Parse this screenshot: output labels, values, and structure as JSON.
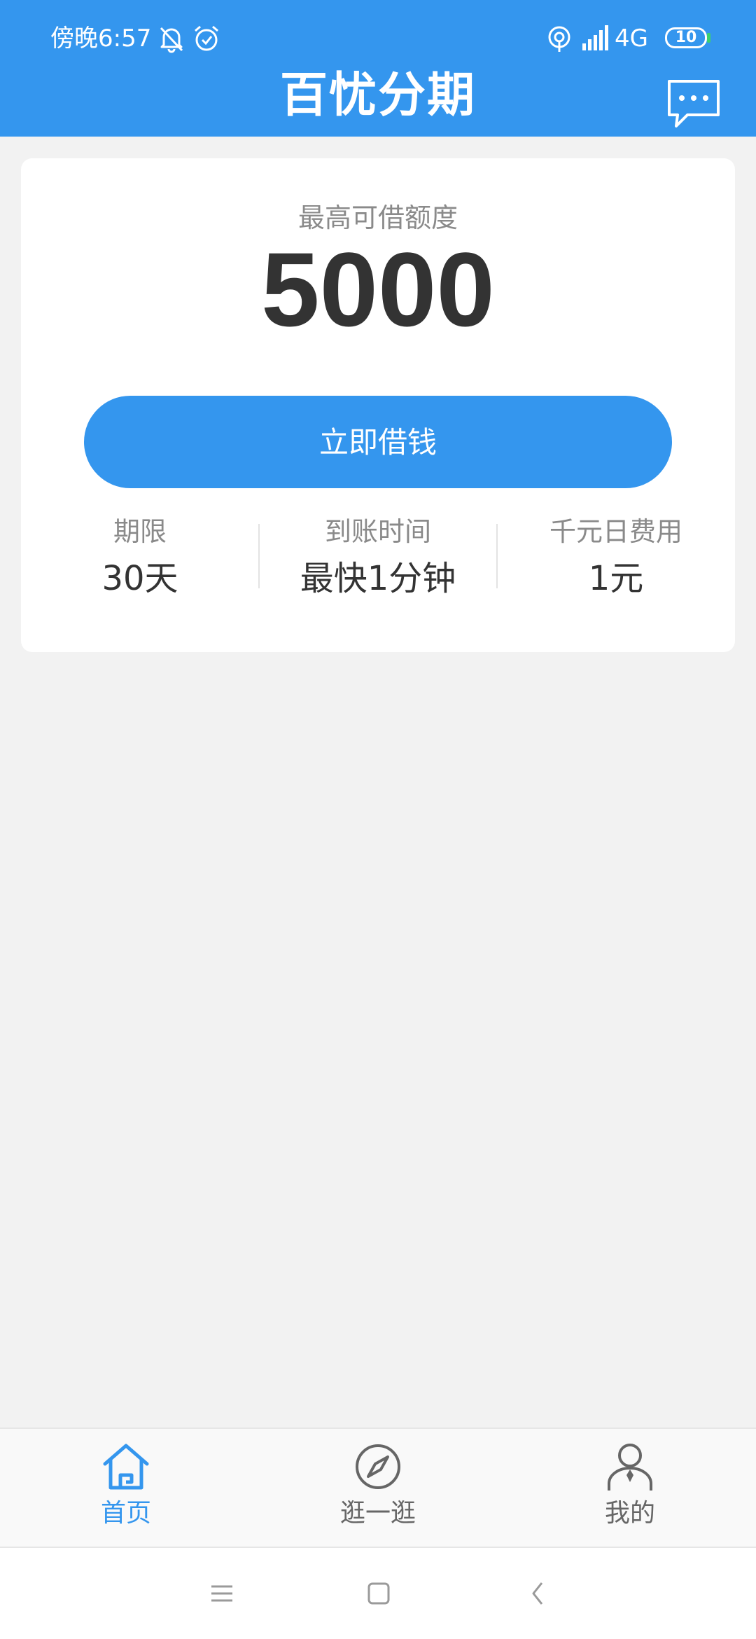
{
  "status_bar": {
    "time": "傍晚6:57",
    "network": "4G",
    "battery": "10"
  },
  "header": {
    "title": "百忧分期"
  },
  "card": {
    "limit_label": "最高可借额度",
    "limit_value": "5000",
    "borrow_button": "立即借钱",
    "stats": [
      {
        "label": "期限",
        "value": "30天"
      },
      {
        "label": "到账时间",
        "value": "最快1分钟"
      },
      {
        "label": "千元日费用",
        "value": "1元"
      }
    ]
  },
  "tabbar": {
    "tabs": [
      {
        "label": "首页",
        "icon": "home-icon",
        "active": true
      },
      {
        "label": "逛一逛",
        "icon": "compass-icon",
        "active": false
      },
      {
        "label": "我的",
        "icon": "user-icon",
        "active": false
      }
    ]
  },
  "colors": {
    "primary": "#3496ee",
    "text_dark": "#333333",
    "text_gray": "#8a8a8a",
    "background": "#f2f2f2",
    "battery_green": "#3bd16f"
  }
}
